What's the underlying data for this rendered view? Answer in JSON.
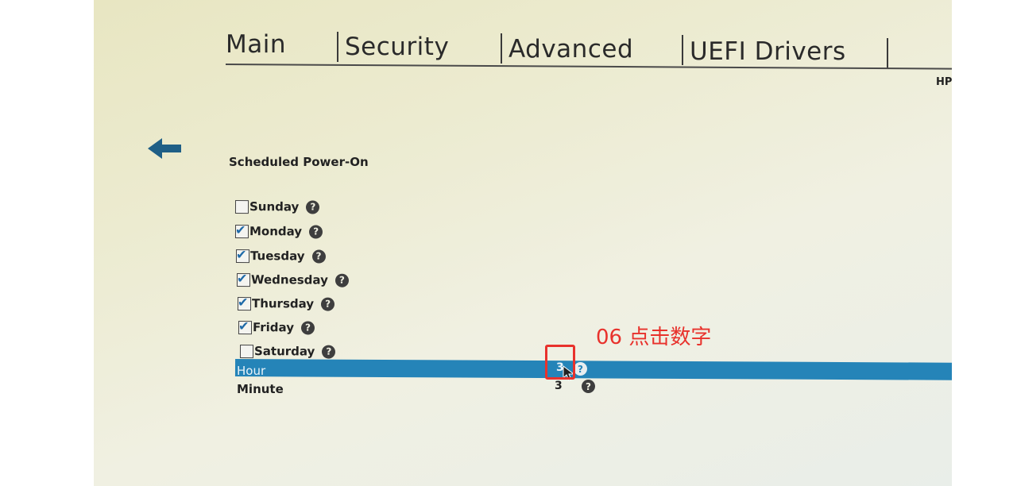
{
  "tabs": [
    {
      "label": "Main"
    },
    {
      "label": "Security"
    },
    {
      "label": "Advanced"
    },
    {
      "label": "UEFI Drivers"
    }
  ],
  "brand": "HP",
  "section_title": "Scheduled Power-On",
  "days": [
    {
      "label": "Sunday",
      "checked": false
    },
    {
      "label": "Monday",
      "checked": true
    },
    {
      "label": "Tuesday",
      "checked": true
    },
    {
      "label": "Wednesday",
      "checked": true
    },
    {
      "label": "Thursday",
      "checked": true
    },
    {
      "label": "Friday",
      "checked": true
    },
    {
      "label": "Saturday",
      "checked": false
    }
  ],
  "help_glyph": "?",
  "check_glyph": "✔",
  "hour": {
    "label": "Hour",
    "value": "3"
  },
  "minute": {
    "label": "Minute",
    "value": "3"
  },
  "annotation": "06 点击数字",
  "colors": {
    "highlight_bar": "#2584b8",
    "annotation": "#e8322c",
    "back_arrow": "#1f5f86"
  }
}
